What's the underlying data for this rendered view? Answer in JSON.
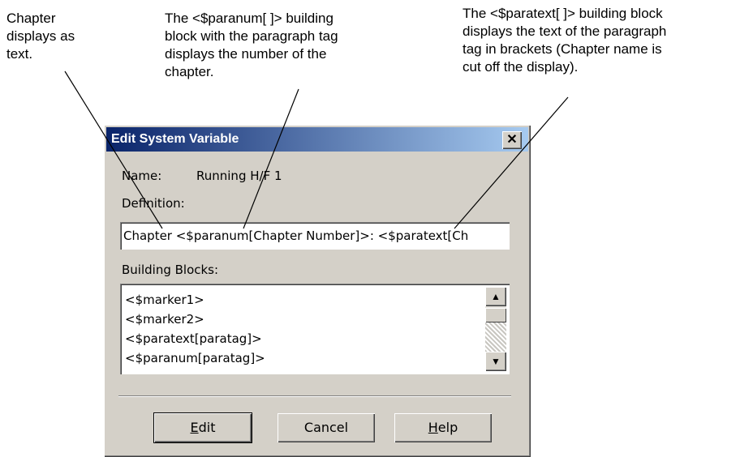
{
  "callouts": {
    "chapter_text": "Chapter\ndisplays as\ntext.",
    "paranum": " The <$paranum[ ]> building\nblock with the paragraph tag\ndisplays the number of the\nchapter.",
    "paratext": "The <$paratext[ ]> building block\ndisplays the text of the paragraph\ntag in brackets (Chapter name is\ncut off the display)."
  },
  "dialog": {
    "title": "Edit System Variable",
    "close_glyph": "✕",
    "name_label": "Name:",
    "name_value": "Running H/F 1",
    "definition_label": "Definition:",
    "definition_value": "Chapter <$paranum[Chapter Number]>: <$paratext[Ch",
    "building_blocks_label": "Building Blocks:",
    "building_blocks": [
      "<$marker1>",
      "<$marker2>",
      "<$paratext[paratag]>",
      "<$paranum[paratag]>"
    ],
    "buttons": {
      "edit": {
        "mnemonic": "E",
        "rest": "dit"
      },
      "cancel": "Cancel",
      "help": {
        "mnemonic": "H",
        "rest": "elp"
      }
    }
  }
}
